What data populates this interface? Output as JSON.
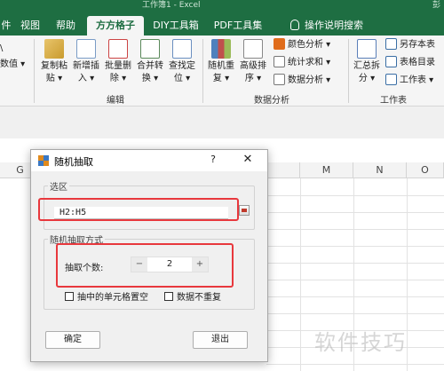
{
  "window": {
    "doc_title": "工作簿1 - Excel",
    "user": "彭"
  },
  "tabs": [
    {
      "label": "件"
    },
    {
      "label": "视图"
    },
    {
      "label": "帮助"
    },
    {
      "label": "方方格子"
    },
    {
      "label": "DIY工具箱"
    },
    {
      "label": "PDF工具集"
    },
    {
      "label": "操作说明搜索"
    }
  ],
  "ribbon": {
    "left_partial": [
      "\\",
      "数值 ▾"
    ],
    "groups": [
      {
        "label": "编辑"
      },
      {
        "label": "数据分析"
      },
      {
        "label": "工作表"
      }
    ],
    "buttons": [
      {
        "l1": "复制粘",
        "l2": "贴 ▾"
      },
      {
        "l1": "新增插",
        "l2": "入 ▾"
      },
      {
        "l1": "批量删",
        "l2": "除 ▾"
      },
      {
        "l1": "合并转",
        "l2": "换 ▾"
      },
      {
        "l1": "查找定",
        "l2": "位 ▾"
      },
      {
        "l1": "随机重",
        "l2": "复 ▾"
      },
      {
        "l1": "高级排",
        "l2": "序 ▾"
      },
      {
        "l1": "汇总拆",
        "l2": "分 ▾"
      }
    ],
    "small": [
      "颜色分析 ▾",
      "统计求和 ▾",
      "数据分析 ▾",
      "另存本表",
      "表格目录",
      "工作表 ▾"
    ]
  },
  "columns": [
    "G",
    "M",
    "N",
    "O"
  ],
  "dialog": {
    "title": "随机抽取",
    "help": "?",
    "close": "✕",
    "section_range": "选区",
    "range_value": "H2:H5",
    "section_mode": "随机抽取方式",
    "count_label": "抽取个数:",
    "minus": "−",
    "count_value": "2",
    "plus": "+",
    "chk_clear": "抽中的单元格置空",
    "chk_unique": "数据不重复",
    "ok": "确定",
    "exit": "退出"
  },
  "watermark": "软件技巧",
  "colors": {
    "accent": "#1e6e42",
    "highlight": "#e8383d"
  }
}
